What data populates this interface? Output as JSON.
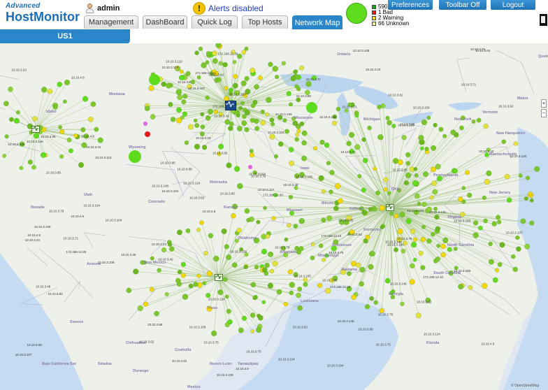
{
  "brand": {
    "line1": "Advanced",
    "line2": "HostMonitor"
  },
  "user": {
    "name": "admin",
    "icon": "user-icon"
  },
  "alerts": {
    "label": "Alerts disabled",
    "icon": "warning-icon"
  },
  "tabs": [
    {
      "label": "Management",
      "active": false
    },
    {
      "label": "DashBoard",
      "active": false
    },
    {
      "label": "Quick Log",
      "active": false
    },
    {
      "label": "Top Hosts",
      "active": false
    },
    {
      "label": "Network Map",
      "active": true
    }
  ],
  "status": {
    "summary": [
      {
        "label": "590 Good",
        "color": "#19a819"
      },
      {
        "label": "1 Bad",
        "color": "#e21b1b"
      },
      {
        "label": "2 Warning",
        "color": "#f5d60a"
      },
      {
        "label": "66 Unknown",
        "color": "#f2f2a0"
      }
    ],
    "pie_color": "#5fdc1e"
  },
  "top_buttons": {
    "preferences": "Preferences",
    "toolbar": "Toolbar Off",
    "logout": "Logout"
  },
  "subtab": "US1",
  "map": {
    "regions": [
      "Ontario",
      "Quebec",
      "Montana",
      "Idaho",
      "Wyoming",
      "Utah",
      "Nevada",
      "Colorado",
      "Kansas",
      "Arizona",
      "New Mexico",
      "Texas",
      "Missouri",
      "Arkansas",
      "Mississippi",
      "Louisiana",
      "Alabama",
      "Georgia",
      "Michigan",
      "Wisconsin",
      "Ohio",
      "Indiana",
      "Illinois",
      "Kentucky",
      "Tennessee",
      "Virginia",
      "Pennsylvania",
      "New York",
      "New Jersey",
      "Massachusetts",
      "Vermont",
      "New Hampshire",
      "Maine",
      "North Carolina",
      "South Carolina",
      "Florida",
      "Oklahoma",
      "Nebraska",
      "Iowa",
      "Mexico",
      "Chihuahua",
      "Sonora",
      "Sinaloa",
      "Coahuila",
      "Nuevo León",
      "Tamaulipas",
      "Durango",
      "Baja California Sur"
    ],
    "ip_labels": [
      "10.10.3.75",
      "10.10.3.79",
      "10.10.3.62",
      "10.10.3.42",
      "10.10.3.46",
      "10.10.3.23",
      "10.10.3.124",
      "10.10.3.146",
      "10.10.3.85",
      "10.10.3.71",
      "10.10.3.108",
      "10.10.3.105",
      "10.10.3.159",
      "10.10.3.104",
      "10.10.3.107",
      "10.10.3.106",
      "10.10.3.110",
      "10.10.3.95",
      "10.10.3.82",
      "10.10.3.88",
      "10.10.4.5",
      "172.168.12.10",
      "172.168.12.30",
      "10.10.4.8"
    ],
    "host_nodes": [
      "hub-north",
      "hub-west",
      "hub-east",
      "hub-south"
    ],
    "attribution": "© OpenStreetMap"
  },
  "zoom": {
    "in": "+",
    "out": "−"
  }
}
